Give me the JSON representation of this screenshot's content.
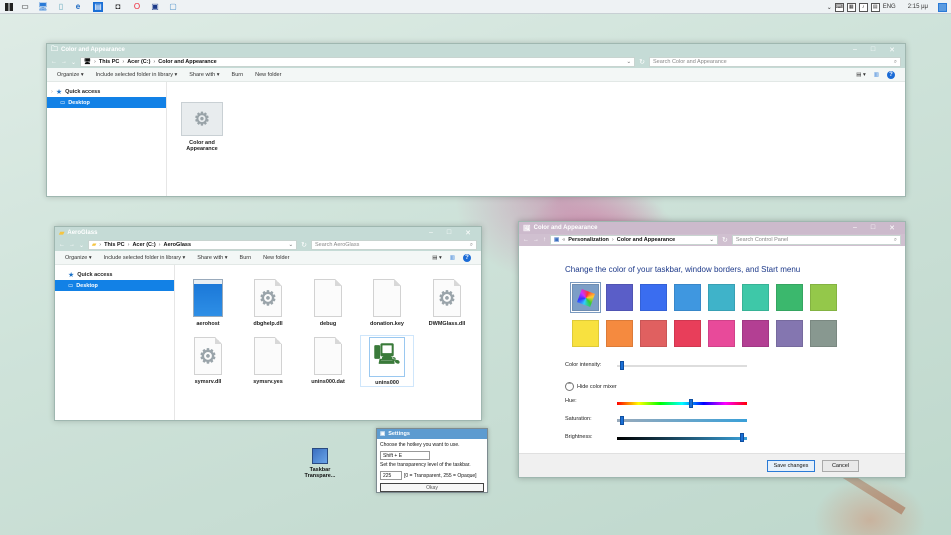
{
  "taskbar": {
    "tray": {
      "language": "ENG",
      "time": "2:15 μμ"
    }
  },
  "window_color_appearance_explorer": {
    "title": "Color and Appearance",
    "breadcrumb": [
      "This PC",
      "Acer (C:)",
      "Color and Appearance"
    ],
    "search_placeholder": "Search Color and Appearance",
    "commands": [
      "Organize ▾",
      "Include selected folder in library ▾",
      "Share with ▾",
      "Burn",
      "New folder"
    ],
    "nav": [
      {
        "label": "Quick access"
      },
      {
        "label": "Desktop"
      }
    ],
    "files": [
      {
        "name": "Color and Appearance"
      }
    ]
  },
  "window_aeroglass": {
    "title": "AeroGlass",
    "breadcrumb": [
      "This PC",
      "Acer (C:)",
      "AeroGlass"
    ],
    "search_placeholder": "Search AeroGlass",
    "commands": [
      "Organize ▾",
      "Include selected folder in library ▾",
      "Share with ▾",
      "Burn",
      "New folder"
    ],
    "nav": [
      {
        "label": "Quick access"
      },
      {
        "label": "Desktop"
      }
    ],
    "files": [
      {
        "name": "aerohost"
      },
      {
        "name": "dbghelp.dll"
      },
      {
        "name": "debug"
      },
      {
        "name": "donation.key"
      },
      {
        "name": "DWMGlass.dll"
      },
      {
        "name": "symsrv.dll"
      },
      {
        "name": "symsrv.yes"
      },
      {
        "name": "unins000.dat"
      },
      {
        "name": "unins000"
      }
    ]
  },
  "color_appearance_panel": {
    "title": "Color and Appearance",
    "breadcrumb": [
      "«",
      "Personalization",
      "Color and Appearance"
    ],
    "search_placeholder": "Search Control Panel",
    "heading": "Change the color of your taskbar, window borders, and Start menu",
    "swatches_row1": [
      "#5a5ec8",
      "#3a6df0",
      "#3f97e0",
      "#3fb3c9",
      "#3ec8a8",
      "#3bb86d",
      "#94c84a"
    ],
    "swatches_row2": [
      "#f8e13f",
      "#f58a3f",
      "#e06060",
      "#e83e5a",
      "#e84a9a",
      "#b33f93",
      "#8476b0",
      "#889890"
    ],
    "color_intensity_label": "Color intensity:",
    "color_intensity_fraction": 0.02,
    "mixer_toggle_label": "Hide color mixer",
    "hue_label": "Hue:",
    "hue_fraction": 0.57,
    "saturation_label": "Saturation:",
    "saturation_fraction": 0.02,
    "brightness_label": "Brightness:",
    "brightness_fraction": 0.98,
    "save_button": "Save changes",
    "cancel_button": "Cancel"
  },
  "settings_dialog": {
    "title": "Settings",
    "hotkey_prompt": "Choose the hotkey you want to use.",
    "hotkey_value": "Shift + E",
    "transparency_prompt": "Set the transparency level of the taskbar.",
    "transparency_value": "225",
    "transparency_hint": "[0 = Transparent, 255 = Opaque]",
    "okay_button": "Okay"
  },
  "desktop_icon": {
    "label": "Taskbar Transpare..."
  }
}
